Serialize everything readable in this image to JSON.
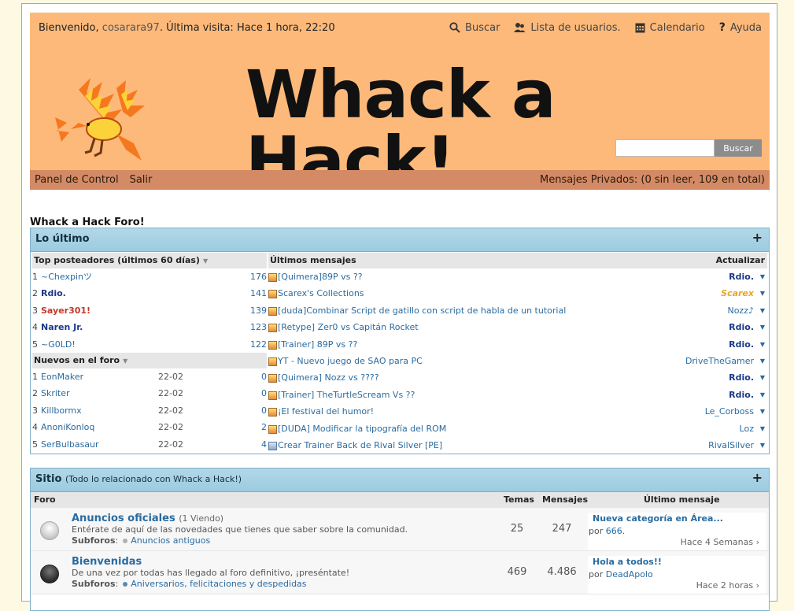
{
  "header": {
    "welcome_prefix": "Bienvenido,",
    "username": "cosarara97",
    "last_visit": ". Última visita: Hace 1 hora, 22:20",
    "nav": [
      {
        "icon": "search-icon",
        "label": "Buscar"
      },
      {
        "icon": "users-icon",
        "label": "Lista de usuarios."
      },
      {
        "icon": "calendar-icon",
        "label": "Calendario"
      },
      {
        "icon": "help-icon",
        "label": "Ayuda"
      }
    ],
    "logo_text": "Whack a Hack!",
    "search_placeholder": "",
    "search_button": "Buscar"
  },
  "control_bar": {
    "panel": "Panel de Control",
    "logout": "Salir",
    "private_messages": "Mensajes Privados: (0 sin leer, 109 en total)"
  },
  "forum_title": "Whack a Hack Foro!",
  "latest": {
    "title": "Lo último",
    "expand_glyph": "+",
    "top_posters_header": "Top posteadores (últimos 60 días)",
    "top_posters": [
      {
        "rank": "1",
        "name": "~Chexpinツ",
        "count": "176",
        "color": "#2a6ba0",
        "bold": false
      },
      {
        "rank": "2",
        "name": "Rdio.",
        "count": "141",
        "color": "#1a3a8a",
        "bold": true
      },
      {
        "rank": "3",
        "name": "Sayer301!",
        "count": "139",
        "color": "#c0392b",
        "bold": true
      },
      {
        "rank": "4",
        "name": "Naren Jr.",
        "count": "123",
        "color": "#1a3a8a",
        "bold": true
      },
      {
        "rank": "5",
        "name": "~G0LD!",
        "count": "122",
        "color": "#2a6ba0",
        "bold": false
      }
    ],
    "new_members_header": "Nuevos en el foro",
    "new_members": [
      {
        "rank": "1",
        "name": "EonMaker",
        "date": "22-02",
        "count": "0"
      },
      {
        "rank": "2",
        "name": "Skriter",
        "date": "22-02",
        "count": "0"
      },
      {
        "rank": "3",
        "name": "Killbormx",
        "date": "22-02",
        "count": "0"
      },
      {
        "rank": "4",
        "name": "AnoniKonloq",
        "date": "22-02",
        "count": "2"
      },
      {
        "rank": "5",
        "name": "SerBulbasaur",
        "date": "22-02",
        "count": "4"
      }
    ],
    "latest_posts_header": "Últimos mensajes",
    "refresh": "Actualizar",
    "dropdown_glyph": "▼",
    "posts": [
      {
        "title": "[Quimera]89P vs ??",
        "author": "Rdio.",
        "style": "bold",
        "icon": "orange"
      },
      {
        "title": "Scarex's Collections",
        "author": "Scarex",
        "style": "gold",
        "icon": "orange"
      },
      {
        "title": "[duda]Combinar Script de gatillo con script de habla de un tutorial",
        "author": "Nozz♪",
        "style": "normal",
        "icon": "orange"
      },
      {
        "title": "[Retype] Zer0 vs Capitán Rocket",
        "author": "Rdio.",
        "style": "bold",
        "icon": "orange"
      },
      {
        "title": "[Trainer] 89P vs ??",
        "author": "Rdio.",
        "style": "bold",
        "icon": "orange"
      },
      {
        "title": "YT - Nuevo juego de SAO para PC",
        "author": "DriveTheGamer",
        "style": "normal",
        "icon": "orange"
      },
      {
        "title": "[Quimera] Nozz vs ????",
        "author": "Rdio.",
        "style": "bold",
        "icon": "orange"
      },
      {
        "title": "[Trainer] TheTurtleScream Vs ??",
        "author": "Rdio.",
        "style": "bold",
        "icon": "orange"
      },
      {
        "title": "¡El festival del humor!",
        "author": "Le_Corboss",
        "style": "normal",
        "icon": "orange"
      },
      {
        "title": "[DUDA] Modificar la tipografía del ROM",
        "author": "Loz",
        "style": "normal",
        "icon": "orange"
      },
      {
        "title": "Crear Trainer Back de Rival Silver [PE]",
        "author": "RivalSilver",
        "style": "normal",
        "icon": "blue"
      }
    ]
  },
  "site": {
    "title": "Sitio",
    "subtitle": "(Todo lo relacionado con Whack a Hack!)",
    "expand_glyph": "+",
    "columns": {
      "forum": "Foro",
      "topics": "Temas",
      "messages": "Mensajes",
      "last": "Último mensaje"
    },
    "forums": [
      {
        "name": "Anuncios oficiales",
        "viewing": "(1 Viendo)",
        "description": "Entérate de aquí de las novedades que tienes que saber sobre la comunidad.",
        "subforums_label": "Subforos",
        "subforums": "Anuncios antiguos",
        "topics": "25",
        "messages": "247",
        "last_title": "Nueva categoría en Área...",
        "last_by": "por",
        "last_user": "666.",
        "last_ago": "Hace 4 Semanas",
        "read": true
      },
      {
        "name": "Bienvenidas",
        "viewing": "",
        "description": "De una vez por todas has llegado al foro definitivo, ¡preséntate!",
        "subforums_label": "Subforos",
        "subforums": "Aniversarios, felicitaciones y despedidas",
        "topics": "469",
        "messages": "4.486",
        "last_title": "Hola a todos!!",
        "last_by": "por",
        "last_user": "DeadApolo",
        "last_ago": "Hace 2 horas",
        "read": false
      }
    ]
  }
}
